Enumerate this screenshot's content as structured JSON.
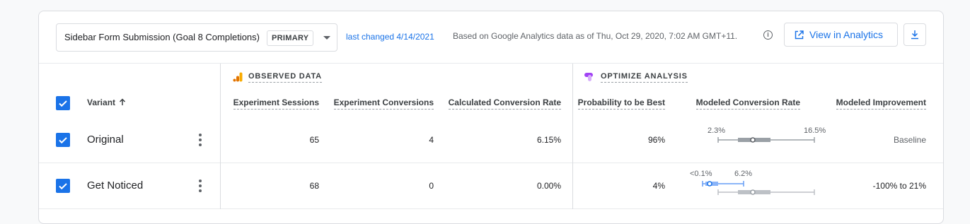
{
  "goal_selector": {
    "label": "Sidebar Form Submission (Goal 8 Completions)",
    "badge": "PRIMARY"
  },
  "last_changed": "last changed 4/14/2021",
  "data_note": "Based on Google Analytics data as of Thu, Oct 29, 2020, 7:02 AM GMT+11.",
  "view_button_label": "View in Analytics",
  "sections": {
    "observed": "OBSERVED DATA",
    "optimize": "OPTIMIZE ANALYSIS"
  },
  "columns": {
    "variant": "Variant",
    "sessions": "Experiment Sessions",
    "conversions": "Experiment Conversions",
    "calc_rate": "Calculated Conversion Rate",
    "prob_best": "Probability to be Best",
    "modeled_rate": "Modeled Conversion Rate",
    "modeled_improvement": "Modeled Improvement"
  },
  "rows": [
    {
      "name": "Original",
      "sessions": "65",
      "conversions": "4",
      "calc_rate": "6.15%",
      "prob_best": "96%",
      "ci_low": "2.3%",
      "ci_high": "16.5%",
      "improvement": "Baseline"
    },
    {
      "name": "Get Noticed",
      "sessions": "68",
      "conversions": "0",
      "calc_rate": "0.00%",
      "prob_best": "4%",
      "ci_low": "<0.1%",
      "ci_high": "6.2%",
      "improvement": "-100% to 21%"
    }
  ],
  "colors": {
    "accent": "#1a73e8",
    "ga_orange": "#f9ab00",
    "optimize_purple": "#a142f4",
    "ci_gray": "#9aa0a6",
    "ci_blue": "#669df6"
  },
  "icons": [
    "dropdown-caret-icon",
    "info-icon",
    "external-link-icon",
    "download-icon",
    "sort-arrow-up-icon",
    "analytics-icon",
    "optimize-icon",
    "more-vert-icon",
    "checkbox-checked-icon"
  ]
}
